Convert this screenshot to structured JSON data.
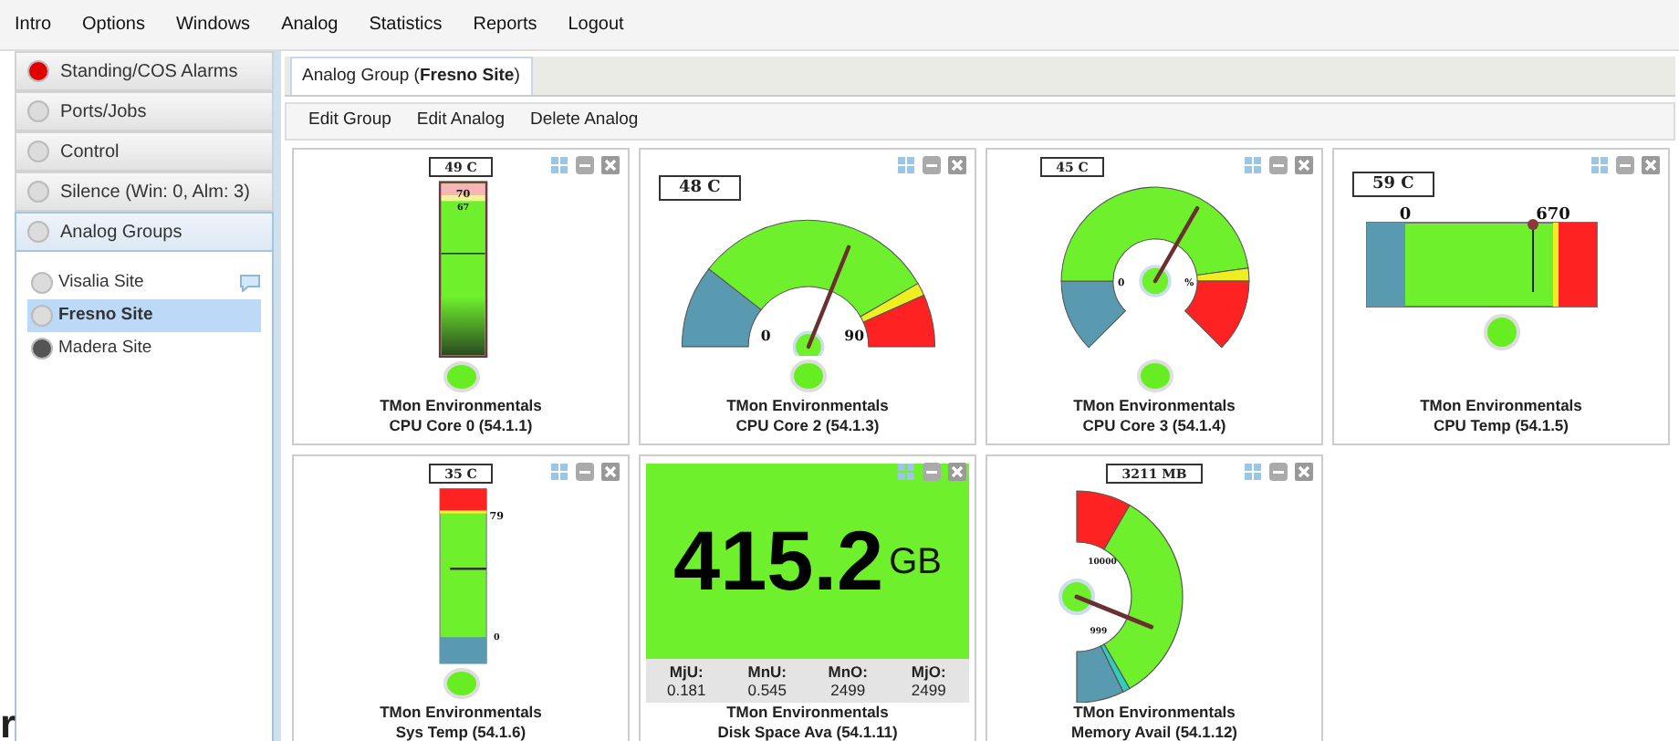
{
  "menu": [
    "Intro",
    "Options",
    "Windows",
    "Analog",
    "Statistics",
    "Reports",
    "Logout"
  ],
  "sidebar": {
    "sections": [
      {
        "label": "Standing/COS Alarms",
        "color": "#e00000",
        "expanded": false
      },
      {
        "label": "Ports/Jobs",
        "color": "#dcdcdc",
        "expanded": false
      },
      {
        "label": "Control",
        "color": "#dcdcdc",
        "expanded": false
      },
      {
        "label": "Silence (Win: 0, Alm: 3)",
        "color": "#dcdcdc",
        "expanded": false
      },
      {
        "label": "Analog Groups",
        "color": "#dcdcdc",
        "expanded": true,
        "items": [
          {
            "label": "Visalia Site",
            "color": "#dcdcdc",
            "selected": false,
            "comment": true
          },
          {
            "label": "Fresno Site",
            "color": "#dcdcdc",
            "selected": true,
            "comment": false
          },
          {
            "label": "Madera Site",
            "color": "#555555",
            "selected": false,
            "comment": false
          }
        ]
      }
    ]
  },
  "tab": {
    "label": "Analog Group (**Fresno Site**)",
    "selected": true
  },
  "toolbar": [
    "Edit Group",
    "Edit Analog",
    "Delete Analog"
  ],
  "widgets": [
    {
      "kind": "vbar",
      "reading": "49 C",
      "scale": [
        "70",
        "67"
      ],
      "color": "#66ee22",
      "title": "TMon Environmentals",
      "subtitle": "CPU Core 0 (54.1.1)"
    },
    {
      "kind": "dial",
      "reading": "48 C",
      "scale": [
        "0",
        "90"
      ],
      "color": "#66ee22",
      "title": "TMon Environmentals",
      "subtitle": "CPU Core 2 (54.1.3)"
    },
    {
      "kind": "dial270",
      "reading": "45 C",
      "scale": [
        "0",
        "%"
      ],
      "color": "#66ee22",
      "title": "TMon Environmentals",
      "subtitle": "CPU Core 3 (54.1.4)"
    },
    {
      "kind": "hbar",
      "reading": "59 C",
      "scale": [
        "0",
        "670"
      ],
      "color": "#66ee22",
      "title": "TMon Environmentals",
      "subtitle": "CPU Temp (54.1.5)"
    },
    {
      "kind": "vbar2",
      "reading": "35 C",
      "scale": [
        "79",
        "0"
      ],
      "color": "#66ee22",
      "title": "TMon Environmentals",
      "subtitle": "Sys Temp (54.1.6)"
    },
    {
      "kind": "bignum",
      "value": "415.2",
      "unit": "GB",
      "stats": [
        {
          "label": "MjU:",
          "value": "0.181"
        },
        {
          "label": "MnU:",
          "value": "0.545"
        },
        {
          "label": "MnO:",
          "value": "2499"
        },
        {
          "label": "MjO:",
          "value": "2499"
        }
      ],
      "title": "TMon Environmentals",
      "subtitle": "Disk Space Ava (54.1.11)"
    },
    {
      "kind": "sidedial",
      "reading": "3211 MB",
      "scale": [
        "10000",
        "999"
      ],
      "title": "TMon Environmentals",
      "subtitle": "Memory Avail (54.1.12)"
    }
  ],
  "stray_text": "r"
}
